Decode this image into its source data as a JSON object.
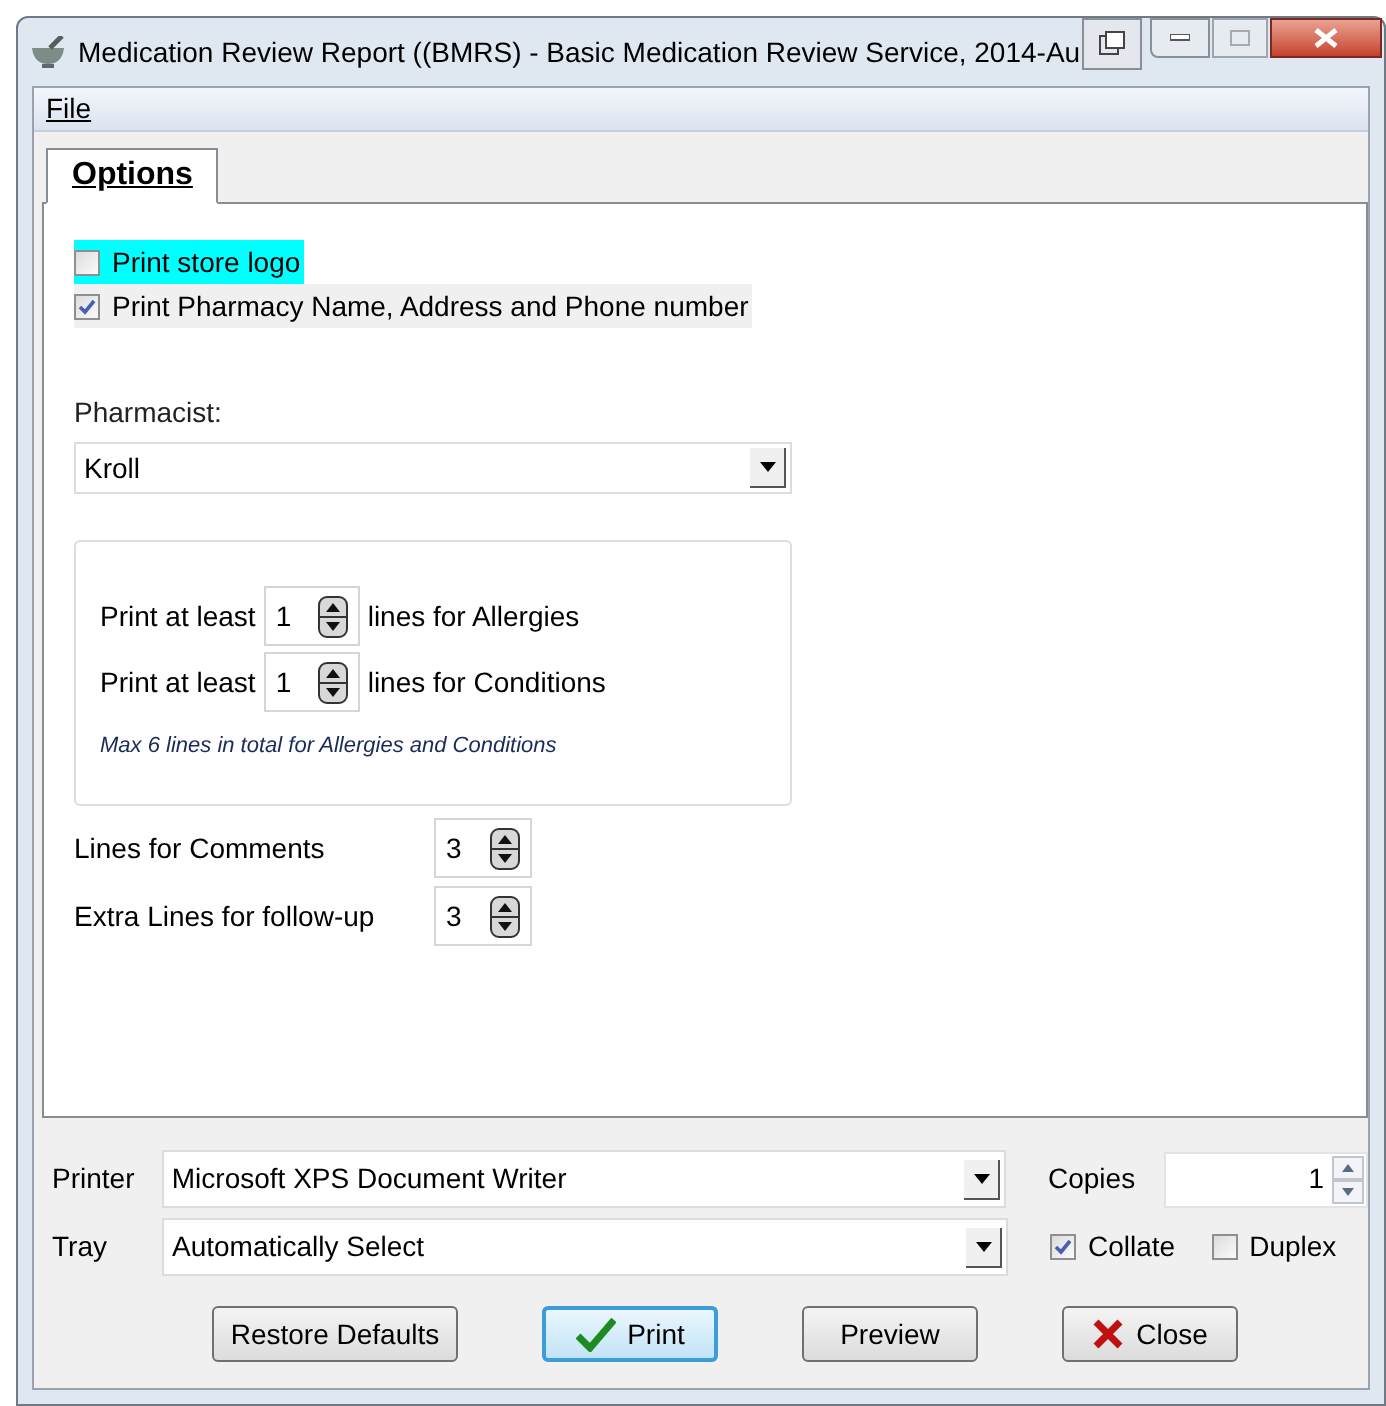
{
  "window": {
    "title": "Medication Review Report ((BMRS) - Basic Medication Review Service, 2014-Au"
  },
  "menu": [
    "File"
  ],
  "tabs": [
    {
      "label": "Options",
      "selected": true
    }
  ],
  "options": [
    {
      "label": "Print store logo",
      "checked": false,
      "highlighted": true
    },
    {
      "label": "Print Pharmacy Name, Address  and Phone number",
      "checked": true,
      "highlighted": false
    }
  ],
  "pharmacist": {
    "label": "Pharmacist:",
    "value": "Kroll"
  },
  "min_lines": {
    "rows": [
      {
        "prefix": "Print at least",
        "value": "1",
        "suffix": "lines for Allergies"
      },
      {
        "prefix": "Print at least",
        "value": "1",
        "suffix": "lines for Conditions"
      }
    ],
    "note": "Max 6 lines in total for Allergies and Conditions"
  },
  "line_settings": [
    {
      "label": "Lines for Comments",
      "value": "3"
    },
    {
      "label": "Extra Lines for follow-up",
      "value": "3"
    }
  ],
  "printer": {
    "label": "Printer",
    "value": "Microsoft XPS Document Writer"
  },
  "copies": {
    "label": "Copies",
    "value": "1"
  },
  "tray": {
    "label": "Tray",
    "value": "Automatically Select"
  },
  "collate": {
    "label": "Collate",
    "checked": true
  },
  "duplex": {
    "label": "Duplex",
    "checked": false
  },
  "buttons": [
    {
      "label": "Restore Defaults",
      "kind": "plain",
      "default": false
    },
    {
      "label": "Print",
      "kind": "confirm",
      "default": true
    },
    {
      "label": "Preview",
      "kind": "plain",
      "default": false
    },
    {
      "label": "Close",
      "kind": "cancel",
      "default": false
    }
  ]
}
